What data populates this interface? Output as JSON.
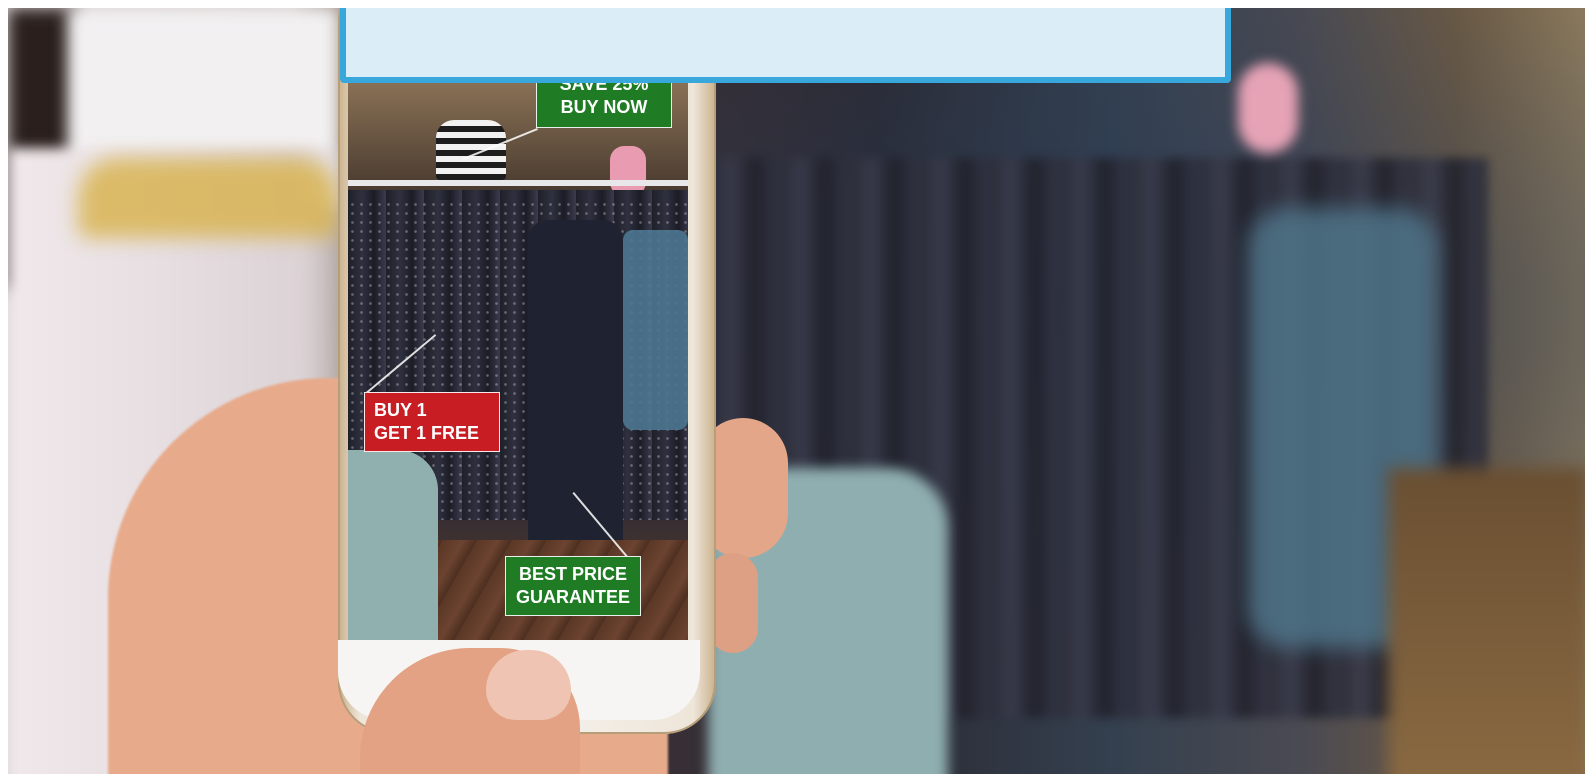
{
  "image": {
    "subject": "hand-holding-smartphone-in-clothing-store"
  },
  "phone_screen": {
    "tags": {
      "save": [
        "SAVE 25%",
        "BUY NOW"
      ],
      "buy_one": [
        "BUY 1",
        "GET 1 FREE"
      ],
      "best_price": [
        "BEST PRICE",
        "GUARANTEE"
      ]
    }
  },
  "colors": {
    "green_tag": "#1f7c25",
    "red_tag": "#c81d23",
    "overlay_border": "#38a8dc",
    "overlay_fill": "#dbeef8"
  }
}
